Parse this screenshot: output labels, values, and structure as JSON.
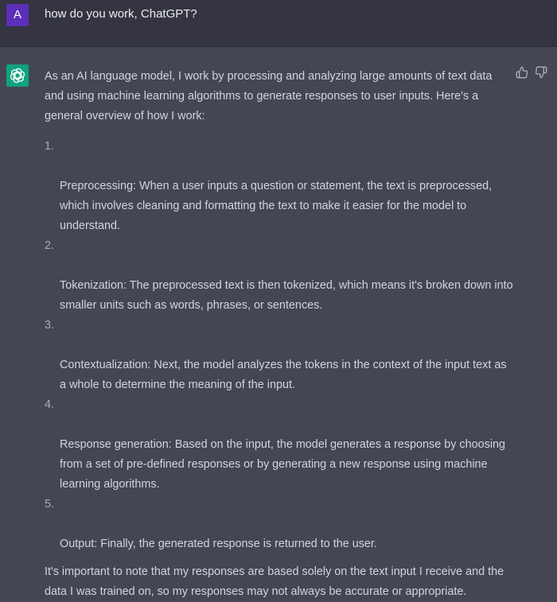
{
  "user": {
    "avatar_letter": "A",
    "message": "how do you work, ChatGPT?"
  },
  "assistant": {
    "avatar_icon": "openai-logo-icon",
    "feedback": {
      "up_icon": "thumbs-up-icon",
      "down_icon": "thumbs-down-icon"
    },
    "intro": "As an AI language model, I work by processing and analyzing large amounts of text data\nand using machine learning algorithms to generate responses to user inputs. Here's a\ngeneral overview of how I work:",
    "steps": [
      {
        "num": "1.",
        "text": "Preprocessing: When a user inputs a question or statement, the text is preprocessed,\nwhich involves cleaning and formatting the text to make it easier for the model to\nunderstand."
      },
      {
        "num": "2.",
        "text": "Tokenization: The preprocessed text is then tokenized, which means it's broken down into\nsmaller units such as words, phrases, or sentences."
      },
      {
        "num": "3.",
        "text": "Contextualization: Next, the model analyzes the tokens in the context of the input text as\na whole to determine the meaning of the input."
      },
      {
        "num": "4.",
        "text": "Response generation: Based on the input, the model generates a response by choosing\nfrom a set of pre-defined responses or by generating a new response using machine\nlearning algorithms."
      },
      {
        "num": "5.",
        "text": "Output: Finally, the generated response is returned to the user."
      }
    ],
    "closing": "It's important to note that my responses are based solely on the text input I receive and the\ndata I was trained on, so my responses may not always be accurate or appropriate."
  },
  "colors": {
    "user_bg": "#343541",
    "assistant_bg": "#444654",
    "user_avatar": "#5b2fb8",
    "gpt_avatar": "#10a37f",
    "text": "#d1d5db"
  }
}
